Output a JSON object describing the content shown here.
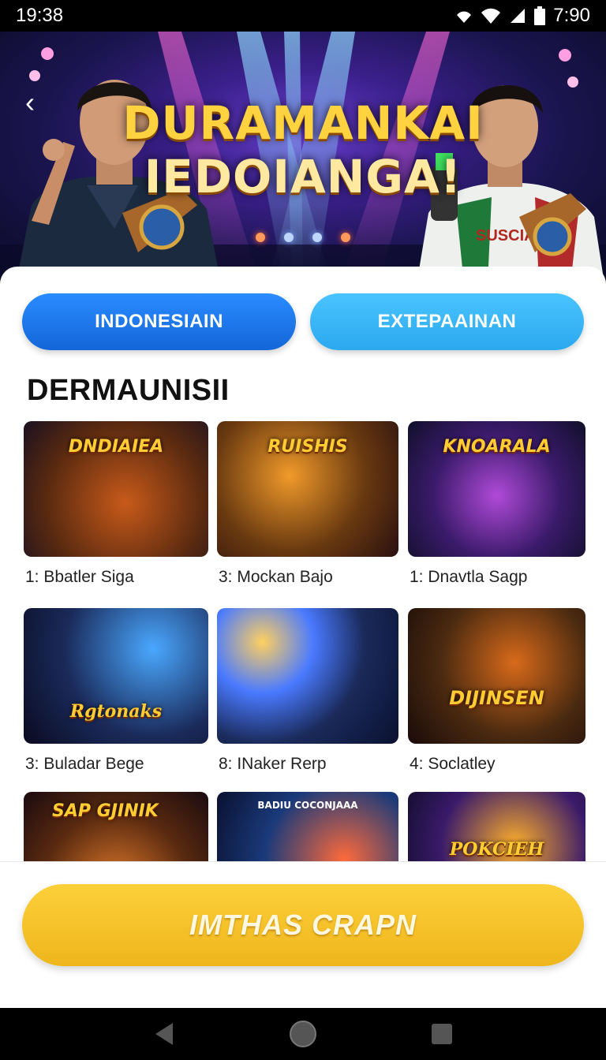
{
  "status_bar": {
    "time_left": "19:38",
    "time_right": "7:90"
  },
  "hero": {
    "title_line1": "DURAMANKAI",
    "title_line2": "IEDOIANGA!",
    "jersey_text": "SUSCIALI",
    "carousel_dots": 4,
    "active_dot": 1
  },
  "tabs": [
    {
      "label": "INDONESIAIN",
      "active": true
    },
    {
      "label": "EXTEPAAINAN",
      "active": false
    }
  ],
  "section": {
    "title": "DERMAUNISII"
  },
  "games": [
    {
      "thumb_title": "DNDIAIEA",
      "label": "1: Bbatler Siga",
      "palette": [
        "#5a2a10",
        "#c85a1a",
        "#1a1020"
      ]
    },
    {
      "thumb_title": "RUISHIS",
      "label": "3: Mockan Bajo",
      "palette": [
        "#6a3a10",
        "#f09a2a",
        "#2a1010"
      ]
    },
    {
      "thumb_title": "KNOARALA",
      "label": "1: Dnavtla Sagp",
      "palette": [
        "#3a1a6a",
        "#b04ad8",
        "#10102a"
      ]
    },
    {
      "thumb_title": "Rgtonaks",
      "label": "3: Buladar Bege",
      "palette": [
        "#1a2a5a",
        "#4aa8ff",
        "#0a0a20"
      ]
    },
    {
      "thumb_title": "",
      "label": "8: INaker Rerp",
      "palette": [
        "#1a2a5a",
        "#4a7aff",
        "#0a1030"
      ]
    },
    {
      "thumb_title": "DIJINSEN",
      "label": "4: Soclatley",
      "palette": [
        "#4a2a10",
        "#d86a1a",
        "#1a0a0a"
      ]
    },
    {
      "thumb_title": "SAP GJINIK",
      "label": "",
      "palette": [
        "#5a2a10",
        "#e07a2a",
        "#1a0a10"
      ]
    },
    {
      "thumb_title": "BADIU COCONJAAA",
      "label": "",
      "palette": [
        "#1a3a7a",
        "#ff6a3a",
        "#0a1030"
      ]
    },
    {
      "thumb_title": "POKCIEH",
      "label": "",
      "palette": [
        "#3a1a6a",
        "#ffb02a",
        "#0a0a20"
      ]
    }
  ],
  "cta": {
    "label": "IMTHAS CRAPN"
  },
  "colors": {
    "primary_tab": "#1a74e8",
    "secondary_tab": "#35b6f4",
    "cta": "#f6c32c"
  }
}
